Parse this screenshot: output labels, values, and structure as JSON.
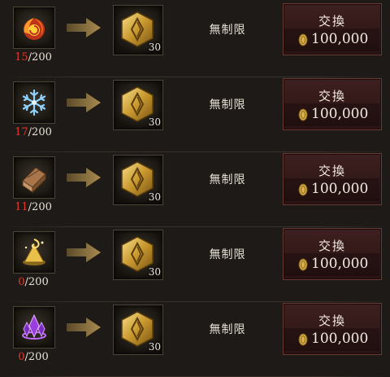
{
  "rows": [
    {
      "source_icon": "fire-orb-icon",
      "have": "15",
      "need": "/200",
      "reward_icon": "gold-rune-icon",
      "reward_qty": "30",
      "limit": "無制限",
      "button_label": "交換",
      "price": "100,000"
    },
    {
      "source_icon": "snowflake-icon",
      "have": "17",
      "need": "/200",
      "reward_icon": "gold-rune-icon",
      "reward_qty": "30",
      "limit": "無制限",
      "button_label": "交換",
      "price": "100,000"
    },
    {
      "source_icon": "wood-log-icon",
      "have": "11",
      "need": "/200",
      "reward_icon": "gold-rune-icon",
      "reward_qty": "30",
      "limit": "無制限",
      "button_label": "交換",
      "price": "100,000"
    },
    {
      "source_icon": "golden-shrine-icon",
      "have": "0",
      "need": "/200",
      "reward_icon": "gold-rune-icon",
      "reward_qty": "30",
      "limit": "無制限",
      "button_label": "交換",
      "price": "100,000"
    },
    {
      "source_icon": "purple-crystal-icon",
      "have": "0",
      "need": "/200",
      "reward_icon": "gold-rune-icon",
      "reward_qty": "30",
      "limit": "無制限",
      "button_label": "交換",
      "price": "100,000"
    }
  ],
  "colors": {
    "background": "#1d1a17",
    "count_red": "#e23b2e",
    "button": "#3d1f1f",
    "gold": "#d8b14a"
  }
}
